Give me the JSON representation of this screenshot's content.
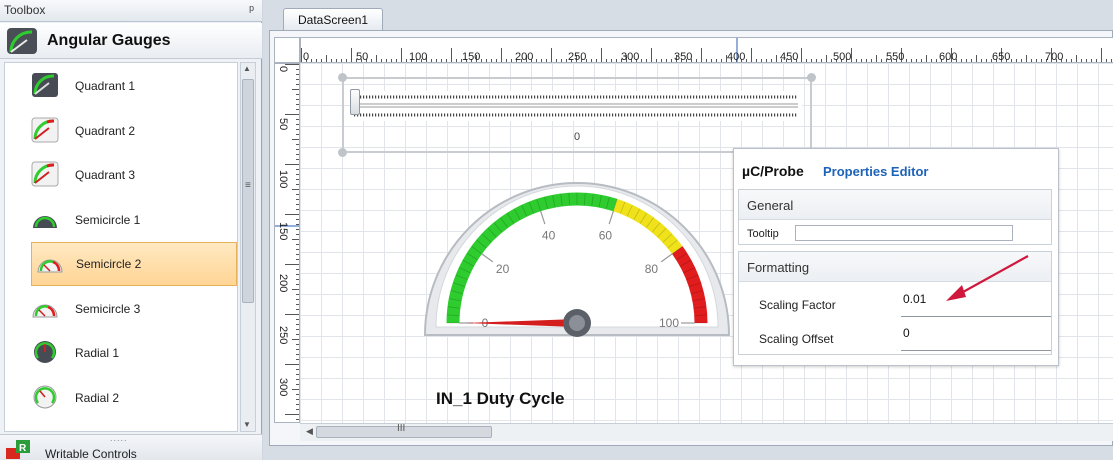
{
  "toolbox": {
    "title": "Toolbox",
    "pin_icon": "ᵖ",
    "group_label": "Angular Gauges",
    "items": [
      {
        "label": "Quadrant 1",
        "icon": "quadrant-dark-icon"
      },
      {
        "label": "Quadrant 2",
        "icon": "quadrant-light-icon"
      },
      {
        "label": "Quadrant 3",
        "icon": "quadrant-light-icon"
      },
      {
        "label": "Semicircle 1",
        "icon": "semicircle-dark-icon"
      },
      {
        "label": "Semicircle 2",
        "icon": "semicircle-light-icon",
        "selected": true
      },
      {
        "label": "Semicircle 3",
        "icon": "semicircle-light-icon"
      },
      {
        "label": "Radial 1",
        "icon": "radial-dark-icon"
      },
      {
        "label": "Radial 2",
        "icon": "radial-light-icon"
      }
    ],
    "footer_label": "Writable Controls"
  },
  "document": {
    "tab_label": "DataScreen1",
    "hruler_labels": [
      "0",
      "50",
      "100",
      "150",
      "200",
      "250",
      "300",
      "350",
      "400",
      "450",
      "500",
      "550",
      "600",
      "650",
      "700"
    ],
    "vruler_labels": [
      "0",
      "50",
      "100",
      "150",
      "200",
      "250",
      "300"
    ],
    "scroll_grip": "III",
    "slider": {
      "value_text": "0"
    },
    "gauge": {
      "title": "IN_1 Duty Cycle",
      "min": 0,
      "max": 100,
      "value": 0,
      "ticks": [
        "0",
        "20",
        "40",
        "60",
        "80",
        "100"
      ],
      "bands": [
        {
          "from": 0,
          "to": 60,
          "color": "#2ecc2e"
        },
        {
          "from": 60,
          "to": 80,
          "color": "#f0e21a"
        },
        {
          "from": 80,
          "to": 100,
          "color": "#e01c1c"
        }
      ]
    }
  },
  "properties": {
    "title": "µC/Probe",
    "subtitle": "Properties Editor",
    "general": {
      "header": "General",
      "tooltip_label": "Tooltip",
      "tooltip_value": ""
    },
    "formatting": {
      "header": "Formatting",
      "scaling_factor_label": "Scaling Factor",
      "scaling_factor_value": "0.01",
      "scaling_offset_label": "Scaling Offset",
      "scaling_offset_value": "0"
    },
    "annotation_arrow_color": "#d0183c"
  }
}
